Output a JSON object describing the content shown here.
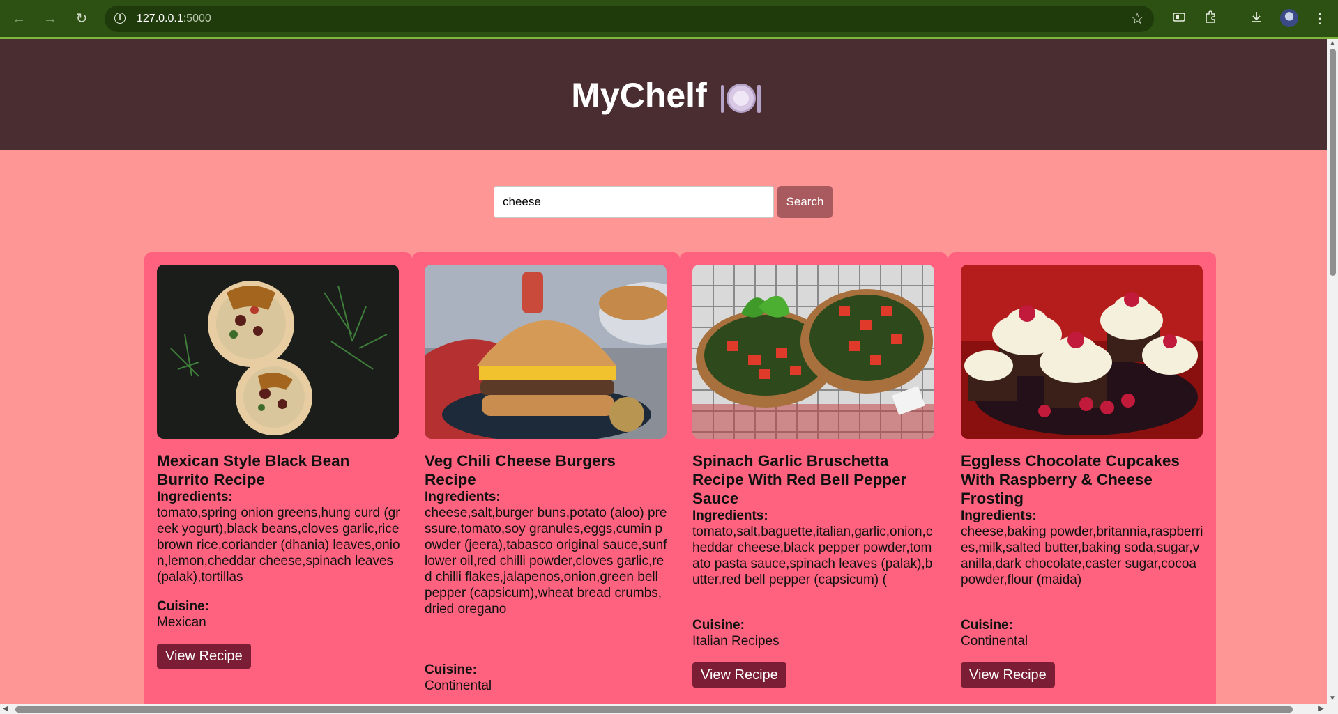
{
  "browser": {
    "url_host": "127.0.0.1",
    "url_port": ":5000",
    "back_icon": "←",
    "forward_icon": "→",
    "reload_icon": "↻"
  },
  "site": {
    "title": "MyChelf",
    "title_icon": "plate-with-cutlery-icon"
  },
  "search": {
    "value": "cheese",
    "button_label": "Search"
  },
  "labels": {
    "ingredients": "Ingredients:",
    "cuisine": "Cuisine:",
    "view_recipe": "View Recipe"
  },
  "recipes": [
    {
      "title": "Mexican Style Black Bean Burrito Recipe",
      "image": "burrito-photo",
      "ingredients": "tomato,spring onion greens,hung curd (greek yogurt),black beans,cloves garlic,rice brown rice,coriander (dhania) leaves,onion,lemon,cheddar cheese,spinach leaves (palak),tortillas",
      "cuisine": "Mexican"
    },
    {
      "title": "Veg Chili Cheese Burgers Recipe",
      "image": "cheese-burger-photo",
      "ingredients": "cheese,salt,burger buns,potato (aloo) pressure,tomato,soy granules,eggs,cumin powder (jeera),tabasco original sauce,sunflower oil,red chilli powder,cloves garlic,red chilli flakes,jalapenos,onion,green bell pepper (capsicum),wheat bread crumbs,dried oregano",
      "cuisine": "Continental"
    },
    {
      "title": "Spinach Garlic Bruschetta Recipe With Red Bell Pepper Sauce",
      "image": "bruschetta-photo",
      "ingredients": "tomato,salt,baguette,italian,garlic,onion,cheddar cheese,black pepper powder,tomato pasta sauce,spinach leaves (palak),butter,red bell pepper (capsicum) (",
      "cuisine": "Italian Recipes"
    },
    {
      "title": "Eggless Chocolate Cupcakes With Raspberry & Cheese Frosting",
      "image": "cupcakes-photo",
      "ingredients": "cheese,baking powder,britannia,raspberries,milk,salted butter,baking soda,sugar,vanilla,dark chocolate,caster sugar,cocoa powder,flour (maida)",
      "cuisine": "Continental"
    }
  ]
}
